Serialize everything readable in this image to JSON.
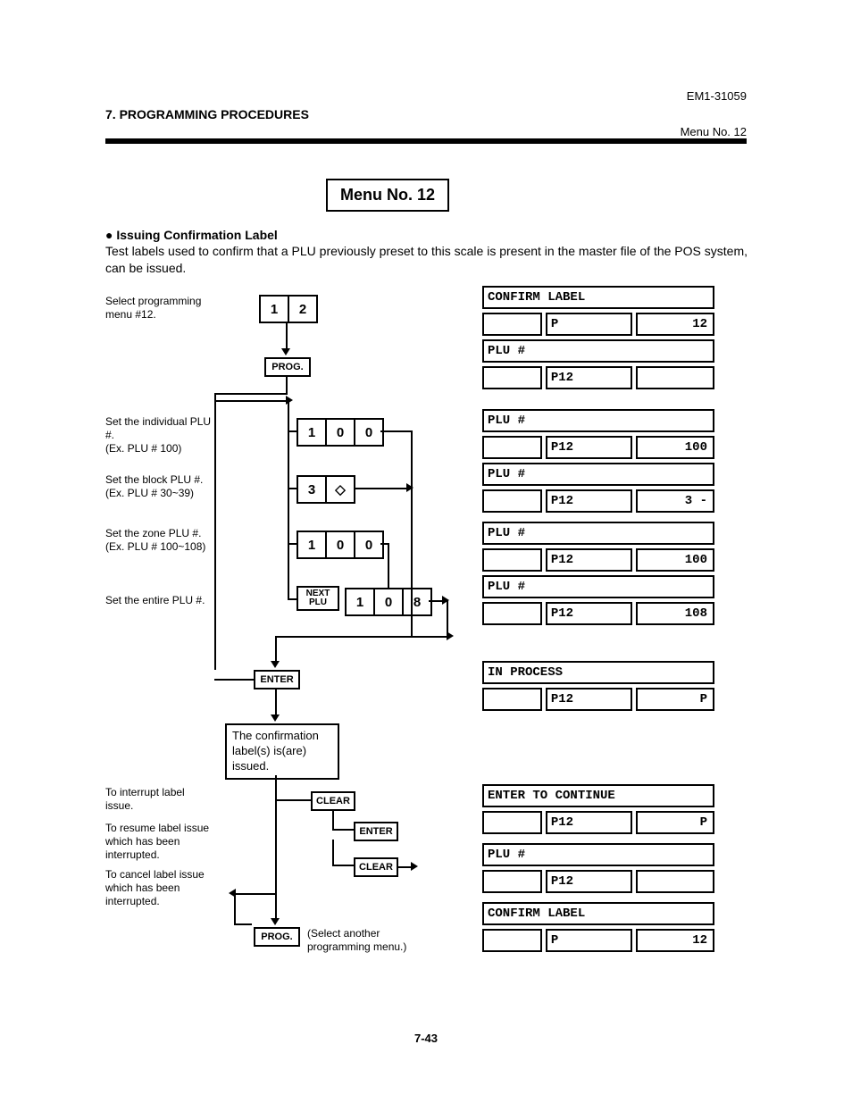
{
  "header": {
    "section": "7. PROGRAMMING PROCEDURES",
    "docno": "EM1-31059",
    "menu": "Menu No. 12"
  },
  "title_box": "Menu No. 12",
  "intro": {
    "heading": "Issuing Confirmation Label",
    "text": "Test labels used to confirm that a PLU previously preset to this scale is present in the master file of the POS system, can be issued."
  },
  "flow": {
    "step1_note": "Select programming menu #12.",
    "step1_keys": [
      "1",
      "2"
    ],
    "prog": "PROG.",
    "step2_note": "Set the individual PLU #.\n(Ex. PLU # 100)",
    "step2_keys": [
      "1",
      "0",
      "0"
    ],
    "step3_note": "Set the block PLU #.\n(Ex. PLU # 30~39)",
    "step3_keys": [
      "3",
      "◇"
    ],
    "step4_note": "Set the zone PLU #.\n(Ex. PLU # 100~108)",
    "step4_keys": [
      "1",
      "0",
      "0"
    ],
    "step5_note": "Set the entire PLU #.",
    "step5_btn": "NEXT\nPLU",
    "step5_keys": [
      "1",
      "0",
      "8"
    ],
    "enter": "ENTER",
    "confirm_msg": "The confirmation label(s) is(are) issued.",
    "int_note": "To interrupt label issue.",
    "clear": "CLEAR",
    "res_note": "To resume label issue which has been interrupted.",
    "enter2": "ENTER",
    "can_note": "To cancel label issue which has been interrupted.",
    "clear2": "CLEAR",
    "prog2": "PROG.",
    "prog2_note": "(Select another programming menu.)"
  },
  "displays": [
    {
      "r1": "CONFIRM LABEL",
      "c1": "",
      "c2": "P",
      "c3": "12"
    },
    {
      "r1": "PLU #",
      "c1": "",
      "c2": "P12",
      "c3": ""
    },
    {
      "r1": "PLU #",
      "c1": "",
      "c2": "P12",
      "c3": "100"
    },
    {
      "r1": "PLU #",
      "c1": "",
      "c2": "P12",
      "c3": "3 -"
    },
    {
      "r1": "PLU #",
      "c1": "",
      "c2": "P12",
      "c3": "100"
    },
    {
      "r1": "PLU #",
      "c1": "",
      "c2": "P12",
      "c3": "108"
    },
    {
      "r1": "IN PROCESS",
      "c1": "",
      "c2": "P12",
      "c3": "P"
    },
    {
      "r1": "ENTER TO CONTINUE",
      "c1": "",
      "c2": "P12",
      "c3": "P"
    },
    {
      "r1": "PLU #",
      "c1": "",
      "c2": "P12",
      "c3": ""
    },
    {
      "r1": "CONFIRM LABEL",
      "c1": "",
      "c2": "P",
      "c3": "12"
    }
  ],
  "pageno": "7-43"
}
